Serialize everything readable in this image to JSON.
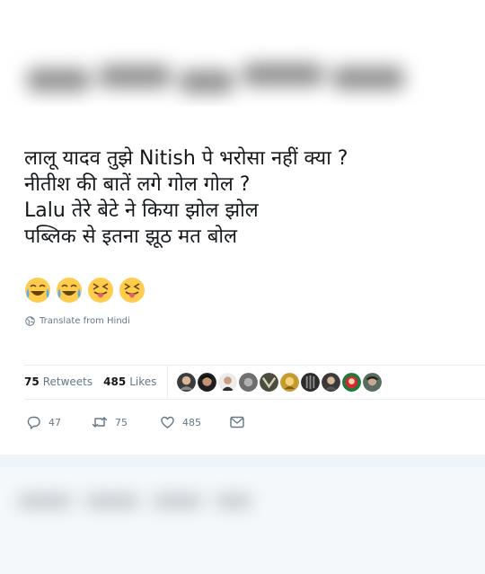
{
  "tweet": {
    "lines": [
      "लालू यादव तुझे Nitish पे भरोसा नहीं क्या ?",
      "नीतीश की बातें लगे गोल गोल ?",
      "Lalu तेरे बेटे ने किया झोल झोल",
      "पब्लिक से इतना झूठ मत बोल"
    ],
    "emojis": [
      "joy-emoji",
      "joy-emoji",
      "squinting-tongue-emoji",
      "squinting-tongue-emoji"
    ]
  },
  "translate": {
    "label": "Translate from Hindi",
    "icon": "globe-icon"
  },
  "stats": {
    "retweets_count": "75",
    "retweets_label": "Retweets",
    "likes_count": "485",
    "likes_label": "Likes",
    "liker_avatars": 10
  },
  "actions": {
    "replies": "47",
    "retweets": "75",
    "likes": "485",
    "icons": [
      "reply-icon",
      "retweet-icon",
      "like-icon",
      "direct-message-icon"
    ]
  },
  "colors": {
    "text": "#14171a",
    "muted": "#657786",
    "divider": "#e6ecf0",
    "background": "#f5f8fa"
  }
}
